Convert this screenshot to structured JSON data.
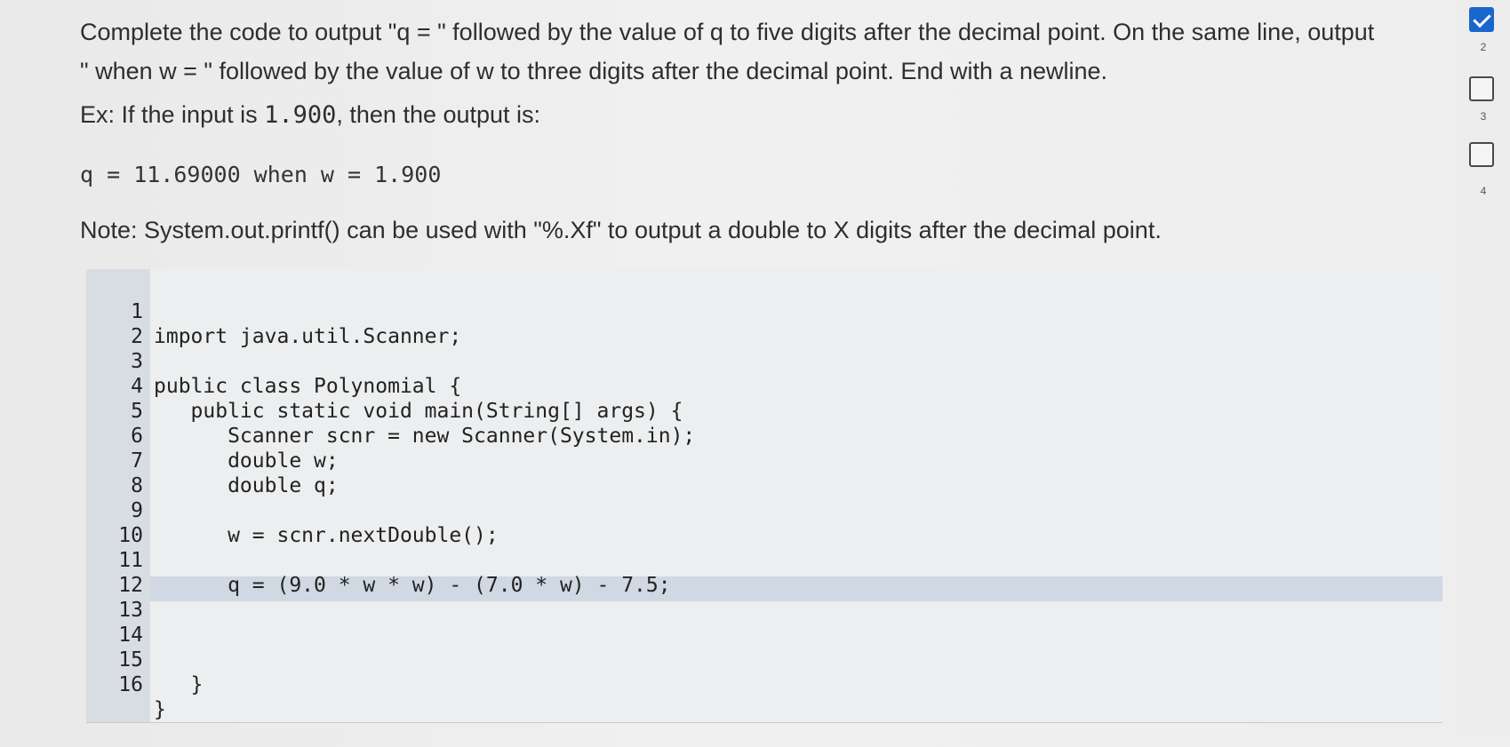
{
  "prompt": {
    "line1": "Complete the code to output \"q = \" followed by the value of q to five digits after the decimal point. On the same line, output",
    "line2": "\" when w = \" followed by the value of w to three digits after the decimal point. End with a newline.",
    "example_prefix": "Ex: If the input is ",
    "example_input": "1.900",
    "example_suffix": ", then the output is:",
    "sample_output": "q = 11.69000 when w = 1.900",
    "note": "Note: System.out.printf() can be used with \"%.Xf\" to output a double to X digits after the decimal point."
  },
  "editor": {
    "lines": [
      {
        "num": "1",
        "code": "import java.util.Scanner;"
      },
      {
        "num": "2",
        "code": ""
      },
      {
        "num": "3",
        "code": "public class Polynomial {"
      },
      {
        "num": "4",
        "code": "   public static void main(String[] args) {"
      },
      {
        "num": "5",
        "code": "      Scanner scnr = new Scanner(System.in);"
      },
      {
        "num": "6",
        "code": "      double w;"
      },
      {
        "num": "7",
        "code": "      double q;"
      },
      {
        "num": "8",
        "code": ""
      },
      {
        "num": "9",
        "code": "      w = scnr.nextDouble();"
      },
      {
        "num": "10",
        "code": ""
      },
      {
        "num": "11",
        "code": "      q = (9.0 * w * w) - (7.0 * w) - 7.5;"
      },
      {
        "num": "12",
        "code": ""
      },
      {
        "num": "13",
        "code": ""
      },
      {
        "num": "14",
        "code": ""
      },
      {
        "num": "15",
        "code": "   }"
      },
      {
        "num": "16",
        "code": "}"
      }
    ]
  },
  "levels": [
    {
      "label": "",
      "completed": true
    },
    {
      "label": "2",
      "completed": false
    },
    {
      "label": "3",
      "completed": false
    },
    {
      "label": "4",
      "completed": false
    }
  ],
  "colors": {
    "gutter": "#d8dde3",
    "editable_line": "#cfd8e3",
    "level_done": "#1a66cc"
  }
}
